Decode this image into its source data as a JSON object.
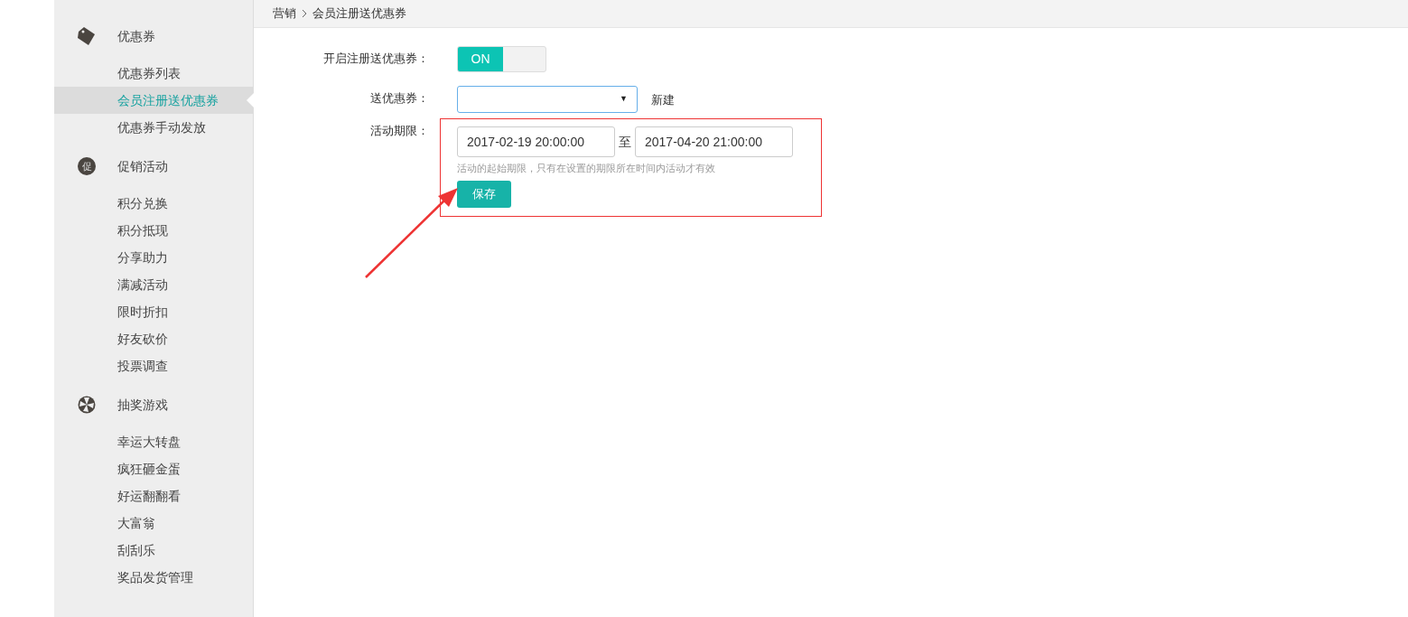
{
  "sidebar": {
    "groups": [
      {
        "kind": "tag",
        "title": "优惠券",
        "items": [
          {
            "label": "优惠券列表",
            "selected": false
          },
          {
            "label": "会员注册送优惠券",
            "selected": true
          },
          {
            "label": "优惠券手动发放",
            "selected": false
          }
        ]
      },
      {
        "kind": "badge",
        "icon_text": "促",
        "title": "促销活动",
        "items": [
          {
            "label": "积分兑换",
            "selected": false
          },
          {
            "label": "积分抵现",
            "selected": false
          },
          {
            "label": "分享助力",
            "selected": false
          },
          {
            "label": "满减活动",
            "selected": false
          },
          {
            "label": "限时折扣",
            "selected": false
          },
          {
            "label": "好友砍价",
            "selected": false
          },
          {
            "label": "投票调查",
            "selected": false
          }
        ]
      },
      {
        "kind": "wheel",
        "title": "抽奖游戏",
        "items": [
          {
            "label": "幸运大转盘",
            "selected": false
          },
          {
            "label": "疯狂砸金蛋",
            "selected": false
          },
          {
            "label": "好运翻翻看",
            "selected": false
          },
          {
            "label": "大富翁",
            "selected": false
          },
          {
            "label": "刮刮乐",
            "selected": false
          },
          {
            "label": "奖品发货管理",
            "selected": false
          }
        ]
      }
    ]
  },
  "breadcrumb": [
    "营销",
    "会员注册送优惠券"
  ],
  "form": {
    "toggle": {
      "label": "开启注册送优惠券：",
      "on": true,
      "text": "ON"
    },
    "coupon": {
      "label": "送优惠券：",
      "caret": "▼",
      "link": "新建"
    },
    "period": {
      "label": "活动期限：",
      "start": "2017-02-19 20:00:00",
      "separator": "至",
      "end": "2017-04-20 21:00:00",
      "hint": "活动的起始期限，只有在设置的期限所在时间内活动才有效"
    },
    "save": "保存"
  }
}
